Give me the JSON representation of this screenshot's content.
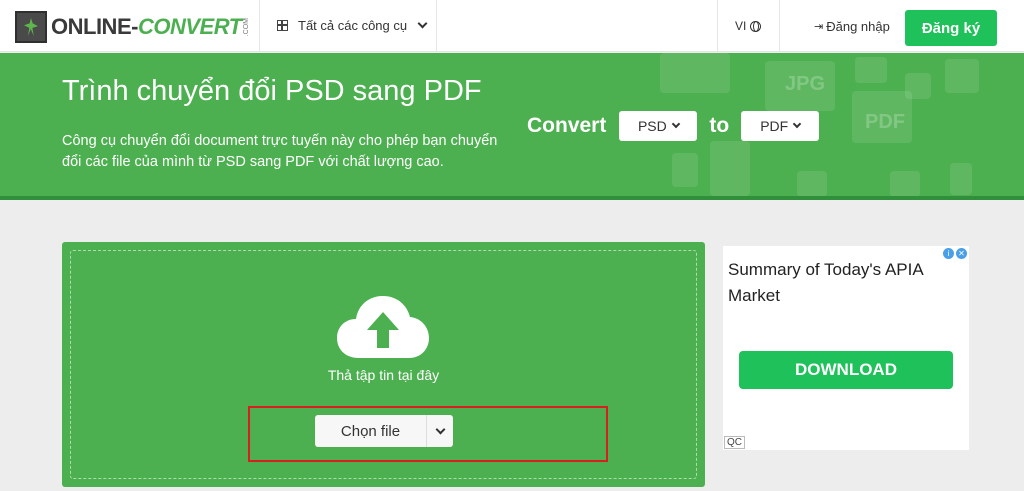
{
  "header": {
    "logo_main": "ONLINE-",
    "logo_accent": "CONVERT",
    "logo_suffix": ".COM",
    "tools_label": "Tất cả các công cụ",
    "language": "VI",
    "login_label": "Đăng nhập",
    "signup_label": "Đăng ký"
  },
  "hero": {
    "title": "Trình chuyển đổi PSD sang PDF",
    "description": "Công cụ chuyển đổi document trực tuyến này cho phép bạn chuyển đổi các file của mình từ PSD sang PDF với chất lượng cao.",
    "convert_label": "Convert",
    "from_format": "PSD",
    "to_label": "to",
    "to_format": "PDF",
    "deco_labels": [
      "JPG",
      "PDF"
    ]
  },
  "upload": {
    "drop_text": "Thả tập tin tại đây",
    "choose_label": "Chọn file"
  },
  "ad": {
    "title": "Summary of Today's APIA Market",
    "button_label": "DOWNLOAD",
    "qc_label": "QC",
    "info_glyph": "i",
    "close_glyph": "✕"
  },
  "colors": {
    "brand_green": "#4db050",
    "signup_green": "#1fc15a",
    "highlight_red": "#d81e1e"
  }
}
